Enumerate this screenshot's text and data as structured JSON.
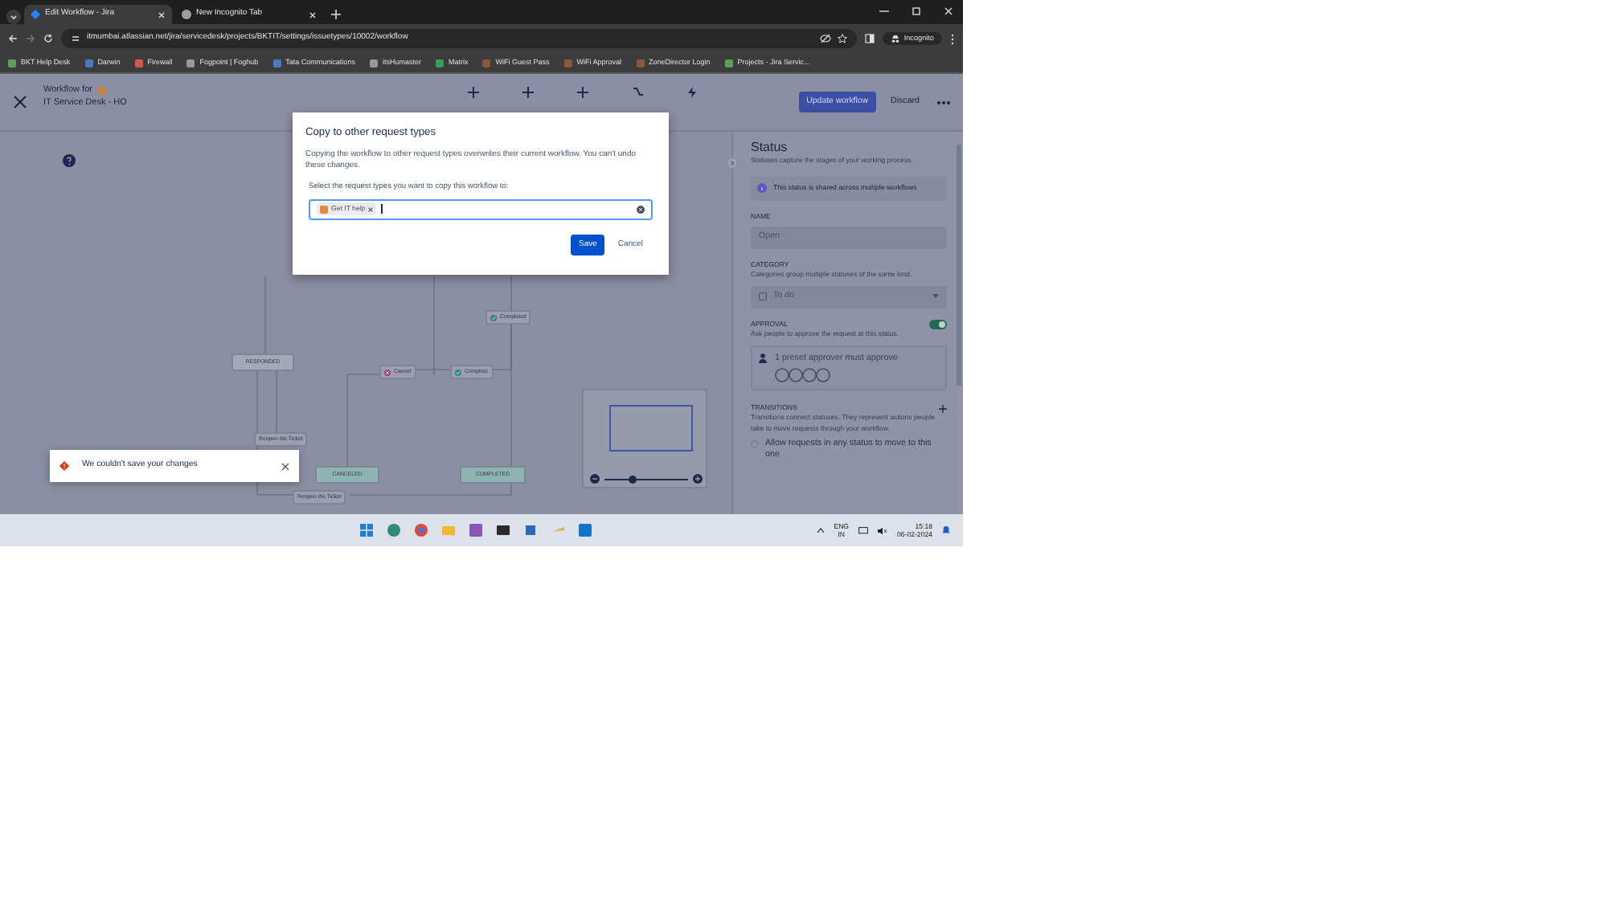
{
  "browser": {
    "tabs": [
      {
        "title": "Edit Workflow - Jira",
        "selected": true
      },
      {
        "title": "New Incognito Tab",
        "selected": false
      }
    ],
    "url": "itmumbai.atlassian.net/jira/servicedesk/projects/BKTIT/settings/issuetypes/10002/workflow",
    "profile": "Incognito",
    "bookmarks": [
      "BKT Help Desk",
      "Darwin",
      "Firewall",
      "Fogpoint | Foghub",
      "Tata Communications",
      "itsHumaster",
      "Matrix",
      "WiFi Guest Pass",
      "WiFi Approval",
      "ZoneDirector Login",
      "Projects - Jira Servic..."
    ]
  },
  "header": {
    "title": "Workflow for",
    "subtitle": "IT Service Desk - HO",
    "actions": [
      {
        "label": "Update workflow",
        "kind": "primary"
      },
      {
        "label": "Discard",
        "kind": "subtle"
      }
    ]
  },
  "diagram": {
    "statuses": [
      {
        "label": "RESPONDED",
        "color": "#a3a8b8"
      },
      {
        "label": "CANCELED",
        "color": "#8fb3b0"
      },
      {
        "label": "COMPLETED",
        "color": "#8fb3b0"
      }
    ],
    "transitions": [
      {
        "label": "Cancel",
        "kind": "cancel"
      },
      {
        "label": "Complete",
        "kind": "complete"
      },
      {
        "label": "Completed",
        "kind": "complete"
      },
      {
        "label": "Reopen the Ticket",
        "kind": "plain"
      },
      {
        "label": "Reopen the Ticket",
        "kind": "plain"
      }
    ]
  },
  "zoom": {
    "level": 0.33
  },
  "modal": {
    "title": "Copy to other request types",
    "body": "Copying the workflow to other request types overwrites their current workflow. You can't undo these changes.",
    "field_label": "Select the request types you want to copy this workflow to:",
    "selected_types": [
      {
        "label": "Get IT help"
      }
    ],
    "buttons": [
      {
        "label": "Save",
        "kind": "primary"
      },
      {
        "label": "Cancel",
        "kind": "subtle"
      }
    ]
  },
  "toast": {
    "message": "We couldn't save your changes"
  },
  "panel": {
    "title": "Status",
    "subtitle": "Statuses capture the stages of your working process.",
    "notice": "This status is shared across multiple workflows",
    "name_label": "NAME",
    "name_value": "Open",
    "category_label": "CATEGORY",
    "category_hint": "Categories group multiple statuses of the same kind.",
    "category_value": "To do",
    "approval_label": "APPROVAL",
    "approval_on": true,
    "approval_hint": "Ask people to approve the request at this status.",
    "approver_text": "1 preset approver must approve",
    "transitions_label": "TRANSITIONS",
    "transitions_hint": "Transitions connect statuses. They represent actions people take to move requests through your workflow.",
    "allow_any": {
      "label": "Allow requests in any status to move to this one",
      "checked": false
    }
  },
  "taskbar": {
    "language": "ENG",
    "region": "IN",
    "time": "15:18",
    "date": "06-02-2024"
  }
}
